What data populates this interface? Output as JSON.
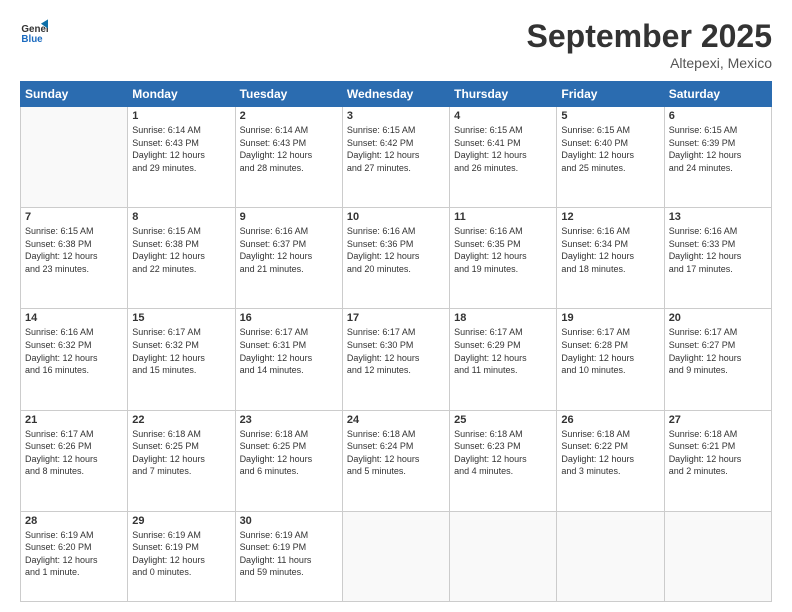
{
  "logo": {
    "line1": "General",
    "line2": "Blue"
  },
  "title": "September 2025",
  "location": "Altepexi, Mexico",
  "weekdays": [
    "Sunday",
    "Monday",
    "Tuesday",
    "Wednesday",
    "Thursday",
    "Friday",
    "Saturday"
  ],
  "weeks": [
    [
      {
        "day": "",
        "info": ""
      },
      {
        "day": "1",
        "info": "Sunrise: 6:14 AM\nSunset: 6:43 PM\nDaylight: 12 hours\nand 29 minutes."
      },
      {
        "day": "2",
        "info": "Sunrise: 6:14 AM\nSunset: 6:43 PM\nDaylight: 12 hours\nand 28 minutes."
      },
      {
        "day": "3",
        "info": "Sunrise: 6:15 AM\nSunset: 6:42 PM\nDaylight: 12 hours\nand 27 minutes."
      },
      {
        "day": "4",
        "info": "Sunrise: 6:15 AM\nSunset: 6:41 PM\nDaylight: 12 hours\nand 26 minutes."
      },
      {
        "day": "5",
        "info": "Sunrise: 6:15 AM\nSunset: 6:40 PM\nDaylight: 12 hours\nand 25 minutes."
      },
      {
        "day": "6",
        "info": "Sunrise: 6:15 AM\nSunset: 6:39 PM\nDaylight: 12 hours\nand 24 minutes."
      }
    ],
    [
      {
        "day": "7",
        "info": "Sunrise: 6:15 AM\nSunset: 6:38 PM\nDaylight: 12 hours\nand 23 minutes."
      },
      {
        "day": "8",
        "info": "Sunrise: 6:15 AM\nSunset: 6:38 PM\nDaylight: 12 hours\nand 22 minutes."
      },
      {
        "day": "9",
        "info": "Sunrise: 6:16 AM\nSunset: 6:37 PM\nDaylight: 12 hours\nand 21 minutes."
      },
      {
        "day": "10",
        "info": "Sunrise: 6:16 AM\nSunset: 6:36 PM\nDaylight: 12 hours\nand 20 minutes."
      },
      {
        "day": "11",
        "info": "Sunrise: 6:16 AM\nSunset: 6:35 PM\nDaylight: 12 hours\nand 19 minutes."
      },
      {
        "day": "12",
        "info": "Sunrise: 6:16 AM\nSunset: 6:34 PM\nDaylight: 12 hours\nand 18 minutes."
      },
      {
        "day": "13",
        "info": "Sunrise: 6:16 AM\nSunset: 6:33 PM\nDaylight: 12 hours\nand 17 minutes."
      }
    ],
    [
      {
        "day": "14",
        "info": "Sunrise: 6:16 AM\nSunset: 6:32 PM\nDaylight: 12 hours\nand 16 minutes."
      },
      {
        "day": "15",
        "info": "Sunrise: 6:17 AM\nSunset: 6:32 PM\nDaylight: 12 hours\nand 15 minutes."
      },
      {
        "day": "16",
        "info": "Sunrise: 6:17 AM\nSunset: 6:31 PM\nDaylight: 12 hours\nand 14 minutes."
      },
      {
        "day": "17",
        "info": "Sunrise: 6:17 AM\nSunset: 6:30 PM\nDaylight: 12 hours\nand 12 minutes."
      },
      {
        "day": "18",
        "info": "Sunrise: 6:17 AM\nSunset: 6:29 PM\nDaylight: 12 hours\nand 11 minutes."
      },
      {
        "day": "19",
        "info": "Sunrise: 6:17 AM\nSunset: 6:28 PM\nDaylight: 12 hours\nand 10 minutes."
      },
      {
        "day": "20",
        "info": "Sunrise: 6:17 AM\nSunset: 6:27 PM\nDaylight: 12 hours\nand 9 minutes."
      }
    ],
    [
      {
        "day": "21",
        "info": "Sunrise: 6:17 AM\nSunset: 6:26 PM\nDaylight: 12 hours\nand 8 minutes."
      },
      {
        "day": "22",
        "info": "Sunrise: 6:18 AM\nSunset: 6:25 PM\nDaylight: 12 hours\nand 7 minutes."
      },
      {
        "day": "23",
        "info": "Sunrise: 6:18 AM\nSunset: 6:25 PM\nDaylight: 12 hours\nand 6 minutes."
      },
      {
        "day": "24",
        "info": "Sunrise: 6:18 AM\nSunset: 6:24 PM\nDaylight: 12 hours\nand 5 minutes."
      },
      {
        "day": "25",
        "info": "Sunrise: 6:18 AM\nSunset: 6:23 PM\nDaylight: 12 hours\nand 4 minutes."
      },
      {
        "day": "26",
        "info": "Sunrise: 6:18 AM\nSunset: 6:22 PM\nDaylight: 12 hours\nand 3 minutes."
      },
      {
        "day": "27",
        "info": "Sunrise: 6:18 AM\nSunset: 6:21 PM\nDaylight: 12 hours\nand 2 minutes."
      }
    ],
    [
      {
        "day": "28",
        "info": "Sunrise: 6:19 AM\nSunset: 6:20 PM\nDaylight: 12 hours\nand 1 minute."
      },
      {
        "day": "29",
        "info": "Sunrise: 6:19 AM\nSunset: 6:19 PM\nDaylight: 12 hours\nand 0 minutes."
      },
      {
        "day": "30",
        "info": "Sunrise: 6:19 AM\nSunset: 6:19 PM\nDaylight: 11 hours\nand 59 minutes."
      },
      {
        "day": "",
        "info": ""
      },
      {
        "day": "",
        "info": ""
      },
      {
        "day": "",
        "info": ""
      },
      {
        "day": "",
        "info": ""
      }
    ]
  ]
}
